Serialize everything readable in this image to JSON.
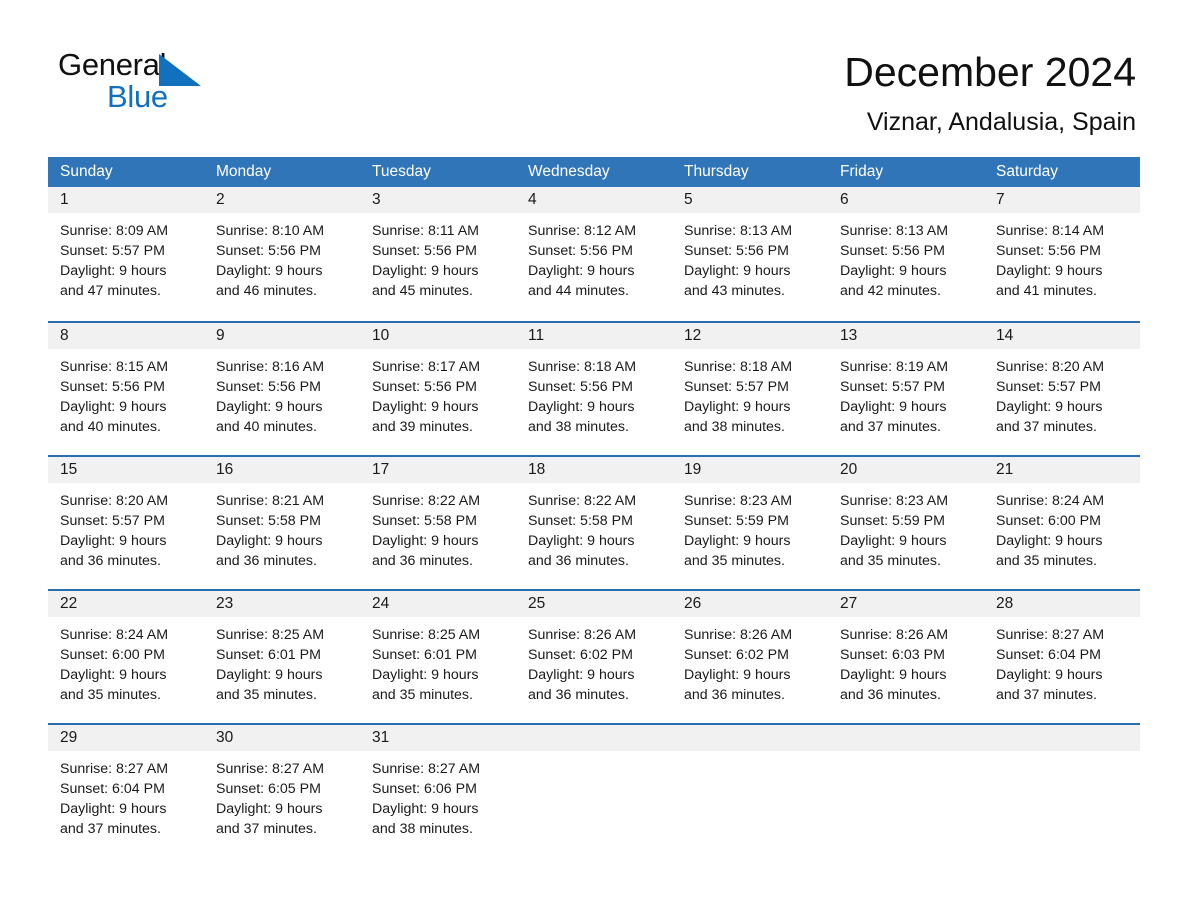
{
  "brand": {
    "name_part1": "General",
    "name_part2": "Blue",
    "triangle_icon": "blue-triangle-icon",
    "accent_color": "#1271bf"
  },
  "header": {
    "title": "December 2024",
    "subtitle": "Viznar, Andalusia, Spain"
  },
  "theme": {
    "header_blue": "#3075b8",
    "rule_blue": "#2a6db0",
    "day_band_gray": "#f1f1f1"
  },
  "weekdays": [
    "Sunday",
    "Monday",
    "Tuesday",
    "Wednesday",
    "Thursday",
    "Friday",
    "Saturday"
  ],
  "weeks": [
    [
      {
        "day": "1",
        "sunrise": "Sunrise: 8:09 AM",
        "sunset": "Sunset: 5:57 PM",
        "daylight1": "Daylight: 9 hours",
        "daylight2": "and 47 minutes."
      },
      {
        "day": "2",
        "sunrise": "Sunrise: 8:10 AM",
        "sunset": "Sunset: 5:56 PM",
        "daylight1": "Daylight: 9 hours",
        "daylight2": "and 46 minutes."
      },
      {
        "day": "3",
        "sunrise": "Sunrise: 8:11 AM",
        "sunset": "Sunset: 5:56 PM",
        "daylight1": "Daylight: 9 hours",
        "daylight2": "and 45 minutes."
      },
      {
        "day": "4",
        "sunrise": "Sunrise: 8:12 AM",
        "sunset": "Sunset: 5:56 PM",
        "daylight1": "Daylight: 9 hours",
        "daylight2": "and 44 minutes."
      },
      {
        "day": "5",
        "sunrise": "Sunrise: 8:13 AM",
        "sunset": "Sunset: 5:56 PM",
        "daylight1": "Daylight: 9 hours",
        "daylight2": "and 43 minutes."
      },
      {
        "day": "6",
        "sunrise": "Sunrise: 8:13 AM",
        "sunset": "Sunset: 5:56 PM",
        "daylight1": "Daylight: 9 hours",
        "daylight2": "and 42 minutes."
      },
      {
        "day": "7",
        "sunrise": "Sunrise: 8:14 AM",
        "sunset": "Sunset: 5:56 PM",
        "daylight1": "Daylight: 9 hours",
        "daylight2": "and 41 minutes."
      }
    ],
    [
      {
        "day": "8",
        "sunrise": "Sunrise: 8:15 AM",
        "sunset": "Sunset: 5:56 PM",
        "daylight1": "Daylight: 9 hours",
        "daylight2": "and 40 minutes."
      },
      {
        "day": "9",
        "sunrise": "Sunrise: 8:16 AM",
        "sunset": "Sunset: 5:56 PM",
        "daylight1": "Daylight: 9 hours",
        "daylight2": "and 40 minutes."
      },
      {
        "day": "10",
        "sunrise": "Sunrise: 8:17 AM",
        "sunset": "Sunset: 5:56 PM",
        "daylight1": "Daylight: 9 hours",
        "daylight2": "and 39 minutes."
      },
      {
        "day": "11",
        "sunrise": "Sunrise: 8:18 AM",
        "sunset": "Sunset: 5:56 PM",
        "daylight1": "Daylight: 9 hours",
        "daylight2": "and 38 minutes."
      },
      {
        "day": "12",
        "sunrise": "Sunrise: 8:18 AM",
        "sunset": "Sunset: 5:57 PM",
        "daylight1": "Daylight: 9 hours",
        "daylight2": "and 38 minutes."
      },
      {
        "day": "13",
        "sunrise": "Sunrise: 8:19 AM",
        "sunset": "Sunset: 5:57 PM",
        "daylight1": "Daylight: 9 hours",
        "daylight2": "and 37 minutes."
      },
      {
        "day": "14",
        "sunrise": "Sunrise: 8:20 AM",
        "sunset": "Sunset: 5:57 PM",
        "daylight1": "Daylight: 9 hours",
        "daylight2": "and 37 minutes."
      }
    ],
    [
      {
        "day": "15",
        "sunrise": "Sunrise: 8:20 AM",
        "sunset": "Sunset: 5:57 PM",
        "daylight1": "Daylight: 9 hours",
        "daylight2": "and 36 minutes."
      },
      {
        "day": "16",
        "sunrise": "Sunrise: 8:21 AM",
        "sunset": "Sunset: 5:58 PM",
        "daylight1": "Daylight: 9 hours",
        "daylight2": "and 36 minutes."
      },
      {
        "day": "17",
        "sunrise": "Sunrise: 8:22 AM",
        "sunset": "Sunset: 5:58 PM",
        "daylight1": "Daylight: 9 hours",
        "daylight2": "and 36 minutes."
      },
      {
        "day": "18",
        "sunrise": "Sunrise: 8:22 AM",
        "sunset": "Sunset: 5:58 PM",
        "daylight1": "Daylight: 9 hours",
        "daylight2": "and 36 minutes."
      },
      {
        "day": "19",
        "sunrise": "Sunrise: 8:23 AM",
        "sunset": "Sunset: 5:59 PM",
        "daylight1": "Daylight: 9 hours",
        "daylight2": "and 35 minutes."
      },
      {
        "day": "20",
        "sunrise": "Sunrise: 8:23 AM",
        "sunset": "Sunset: 5:59 PM",
        "daylight1": "Daylight: 9 hours",
        "daylight2": "and 35 minutes."
      },
      {
        "day": "21",
        "sunrise": "Sunrise: 8:24 AM",
        "sunset": "Sunset: 6:00 PM",
        "daylight1": "Daylight: 9 hours",
        "daylight2": "and 35 minutes."
      }
    ],
    [
      {
        "day": "22",
        "sunrise": "Sunrise: 8:24 AM",
        "sunset": "Sunset: 6:00 PM",
        "daylight1": "Daylight: 9 hours",
        "daylight2": "and 35 minutes."
      },
      {
        "day": "23",
        "sunrise": "Sunrise: 8:25 AM",
        "sunset": "Sunset: 6:01 PM",
        "daylight1": "Daylight: 9 hours",
        "daylight2": "and 35 minutes."
      },
      {
        "day": "24",
        "sunrise": "Sunrise: 8:25 AM",
        "sunset": "Sunset: 6:01 PM",
        "daylight1": "Daylight: 9 hours",
        "daylight2": "and 35 minutes."
      },
      {
        "day": "25",
        "sunrise": "Sunrise: 8:26 AM",
        "sunset": "Sunset: 6:02 PM",
        "daylight1": "Daylight: 9 hours",
        "daylight2": "and 36 minutes."
      },
      {
        "day": "26",
        "sunrise": "Sunrise: 8:26 AM",
        "sunset": "Sunset: 6:02 PM",
        "daylight1": "Daylight: 9 hours",
        "daylight2": "and 36 minutes."
      },
      {
        "day": "27",
        "sunrise": "Sunrise: 8:26 AM",
        "sunset": "Sunset: 6:03 PM",
        "daylight1": "Daylight: 9 hours",
        "daylight2": "and 36 minutes."
      },
      {
        "day": "28",
        "sunrise": "Sunrise: 8:27 AM",
        "sunset": "Sunset: 6:04 PM",
        "daylight1": "Daylight: 9 hours",
        "daylight2": "and 37 minutes."
      }
    ],
    [
      {
        "day": "29",
        "sunrise": "Sunrise: 8:27 AM",
        "sunset": "Sunset: 6:04 PM",
        "daylight1": "Daylight: 9 hours",
        "daylight2": "and 37 minutes."
      },
      {
        "day": "30",
        "sunrise": "Sunrise: 8:27 AM",
        "sunset": "Sunset: 6:05 PM",
        "daylight1": "Daylight: 9 hours",
        "daylight2": "and 37 minutes."
      },
      {
        "day": "31",
        "sunrise": "Sunrise: 8:27 AM",
        "sunset": "Sunset: 6:06 PM",
        "daylight1": "Daylight: 9 hours",
        "daylight2": "and 38 minutes."
      },
      {
        "day": "",
        "sunrise": "",
        "sunset": "",
        "daylight1": "",
        "daylight2": ""
      },
      {
        "day": "",
        "sunrise": "",
        "sunset": "",
        "daylight1": "",
        "daylight2": ""
      },
      {
        "day": "",
        "sunrise": "",
        "sunset": "",
        "daylight1": "",
        "daylight2": ""
      },
      {
        "day": "",
        "sunrise": "",
        "sunset": "",
        "daylight1": "",
        "daylight2": ""
      }
    ]
  ]
}
